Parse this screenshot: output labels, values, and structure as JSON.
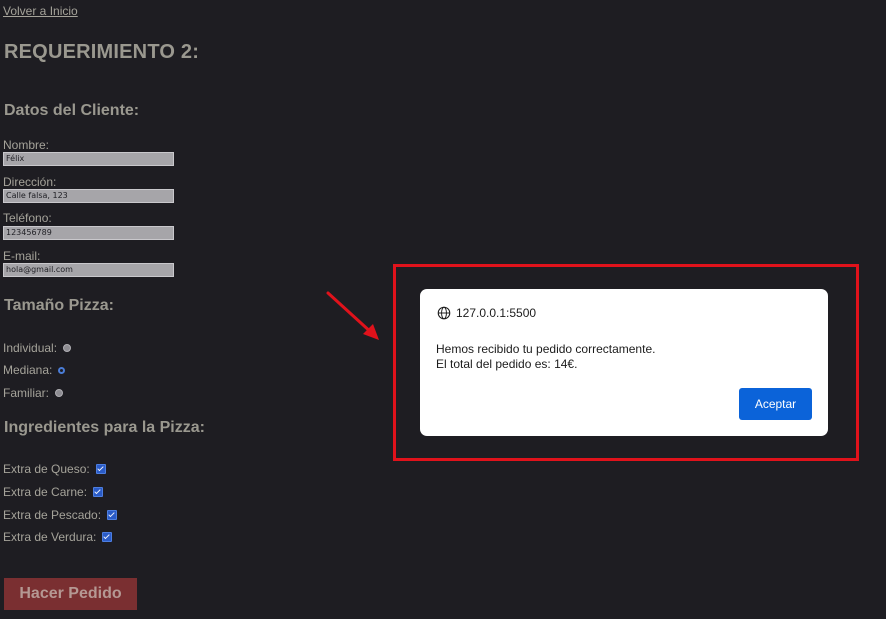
{
  "page": {
    "back_link": "Volver a Inicio",
    "title": "REQUERIMIENTO 2:"
  },
  "client": {
    "heading": "Datos del Cliente:",
    "fields": [
      {
        "label": "Nombre:",
        "value": "Félix"
      },
      {
        "label": "Dirección:",
        "value": "Calle falsa, 123"
      },
      {
        "label": "Teléfono:",
        "value": "123456789"
      },
      {
        "label": "E-mail:",
        "value": "hola@gmail.com"
      }
    ]
  },
  "size": {
    "heading": "Tamaño Pizza:",
    "options": [
      {
        "label": "Individual:",
        "checked": false
      },
      {
        "label": "Mediana:",
        "checked": true
      },
      {
        "label": "Familiar:",
        "checked": false
      }
    ]
  },
  "ingredients": {
    "heading": "Ingredientes para la Pizza:",
    "options": [
      {
        "label": "Extra de Queso:",
        "checked": true
      },
      {
        "label": "Extra de Carne:",
        "checked": true
      },
      {
        "label": "Extra de Pescado:",
        "checked": true
      },
      {
        "label": "Extra de Verdura:",
        "checked": true
      }
    ]
  },
  "order_button": "Hacer Pedido",
  "dialog": {
    "origin": "127.0.0.1:5500",
    "line1": "Hemos recibido tu pedido correctamente.",
    "line2": "El total del pedido es: 14€.",
    "accept": "Aceptar"
  },
  "colors": {
    "background": "#1e1d22",
    "highlight": "#e0121b",
    "accept_button": "#0b63d9",
    "order_button": "#7a2f31"
  }
}
